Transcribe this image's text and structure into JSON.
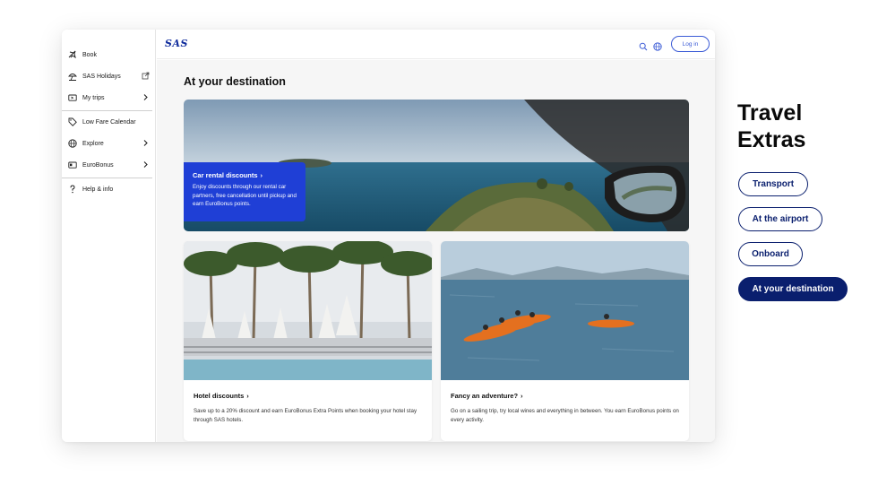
{
  "sidebar": {
    "items": [
      {
        "label": "Book",
        "icon": "plane-icon"
      },
      {
        "label": "SAS Holidays",
        "icon": "beach-umbrella-icon",
        "trailing": "external-link-icon"
      },
      {
        "label": "My trips",
        "icon": "ticket-icon",
        "trailing": "chevron-right-icon"
      },
      {
        "label": "Low Fare Calendar",
        "icon": "tag-icon"
      },
      {
        "label": "Explore",
        "icon": "globe-icon",
        "trailing": "chevron-right-icon"
      },
      {
        "label": "EuroBonus",
        "icon": "card-icon",
        "trailing": "chevron-right-icon"
      },
      {
        "label": "Help & info",
        "icon": "question-icon"
      }
    ]
  },
  "header": {
    "logo": "SAS",
    "login_label": "Log in",
    "icons": [
      "search-icon",
      "globe-icon"
    ]
  },
  "main": {
    "title": "At your destination",
    "hero": {
      "title": "Car rental discounts",
      "description": "Enjoy discounts through our rental car partners, free cancellation until pickup and earn EuroBonus points."
    },
    "cards": [
      {
        "title": "Hotel discounts",
        "description": "Save up to a 20% discount and earn EuroBonus Extra Points when booking your hotel stay through SAS hotels."
      },
      {
        "title": "Fancy an adventure?",
        "description": "Go on a sailing trip, try local wines and everything in between. You earn EuroBonus points on every activity."
      }
    ]
  },
  "panel": {
    "title": "Travel Extras",
    "pills": [
      {
        "label": "Transport",
        "active": false
      },
      {
        "label": "At the airport",
        "active": false
      },
      {
        "label": "Onboard",
        "active": false
      },
      {
        "label": "At your destination",
        "active": true
      }
    ]
  },
  "colors": {
    "brand_blue": "#1f3fd6",
    "navy": "#0a1f6e",
    "login_blue": "#3b5bd6"
  }
}
